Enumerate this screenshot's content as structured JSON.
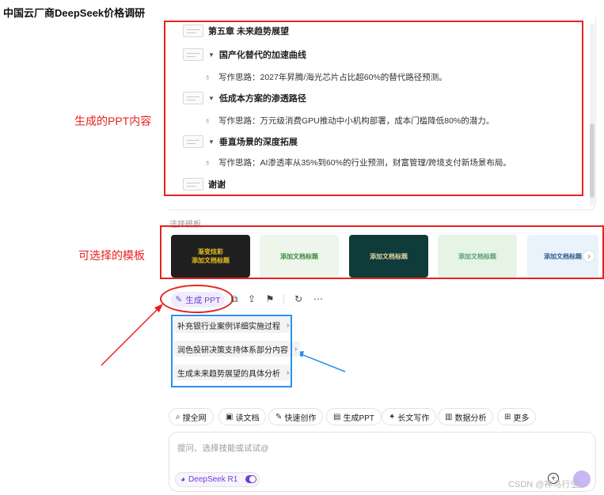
{
  "page_title": "中国云厂商DeepSeek价格调研",
  "outline": {
    "chapter_title": "第五章 未来趋势展望",
    "sections": [
      {
        "heading": "国产化替代的加速曲线",
        "idea": "写作思路：2027年昇腾/海光芯片占比超60%的替代路径预测。"
      },
      {
        "heading": "低成本方案的渗透路径",
        "idea": "写作思路：万元级消费GPU推动中小机构部署，成本门槛降低80%的潜力。"
      },
      {
        "heading": "垂直场景的深度拓展",
        "idea": "写作思路：AI渗透率从35%到60%的行业预测，财富管理/跨境支付新场景布局。"
      }
    ],
    "closing": "谢谢"
  },
  "annotations": {
    "ppt_content": "生成的PPT内容",
    "templates": "可选择的模板"
  },
  "templates": {
    "label": "选择模板",
    "items": [
      {
        "text": "渐变炫彩\n添加文档标题"
      },
      {
        "text": "添加文档标题"
      },
      {
        "text": "添加文档标题"
      },
      {
        "text": "添加文档标题"
      },
      {
        "text": "添加文档标题"
      }
    ],
    "next_icon": "›"
  },
  "actions": {
    "generate_ppt": "生成 PPT",
    "icons": [
      "copy-icon",
      "share-icon",
      "bookmark-icon",
      "refresh-icon",
      "more-icon"
    ]
  },
  "suggestions": [
    {
      "label": "补充银行业案例详细实施过程"
    },
    {
      "label": "润色投研决策支持体系部分内容"
    },
    {
      "label": "生成未来趋势展望的具体分析"
    }
  ],
  "skills": [
    {
      "icon": "⌕",
      "label": "搜全网"
    },
    {
      "icon": "▣",
      "label": "读文档"
    },
    {
      "icon": "✎",
      "label": "快速创作"
    },
    {
      "icon": "▤",
      "label": "生成PPT"
    },
    {
      "icon": "✦",
      "label": "长文写作"
    },
    {
      "icon": "▥",
      "label": "数据分析"
    },
    {
      "icon": "⊞",
      "label": "更多"
    }
  ],
  "input": {
    "placeholder": "提问、选择技能或试试@",
    "model_label": "DeepSeek R1"
  },
  "watermark": "CSDN @神马行空",
  "colors": {
    "accent": "#6b3fd4",
    "annotation_red": "#e82020",
    "annotation_blue": "#2a8ff0"
  }
}
